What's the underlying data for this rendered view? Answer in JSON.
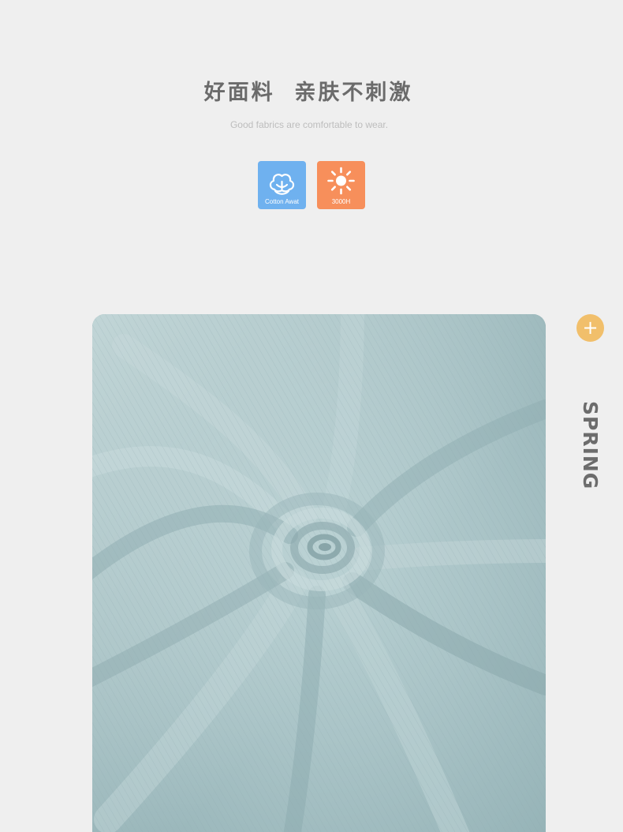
{
  "header": {
    "title": "好面料  亲肤不刺激",
    "subtitle": "Good fabrics are comfortable to wear."
  },
  "badges": [
    {
      "label": "Cotton Awat",
      "icon": "cotton-icon",
      "color": "#6fb1ef"
    },
    {
      "label": "3000H",
      "icon": "sun-icon",
      "color": "#f78f5b"
    }
  ],
  "side": {
    "plus_label": "+",
    "plus_color": "#f1bf6b",
    "season_label": "SPRING"
  },
  "colors": {
    "background": "#efefef",
    "fabric": "#a9c3c6",
    "title": "#6b6b6b"
  }
}
